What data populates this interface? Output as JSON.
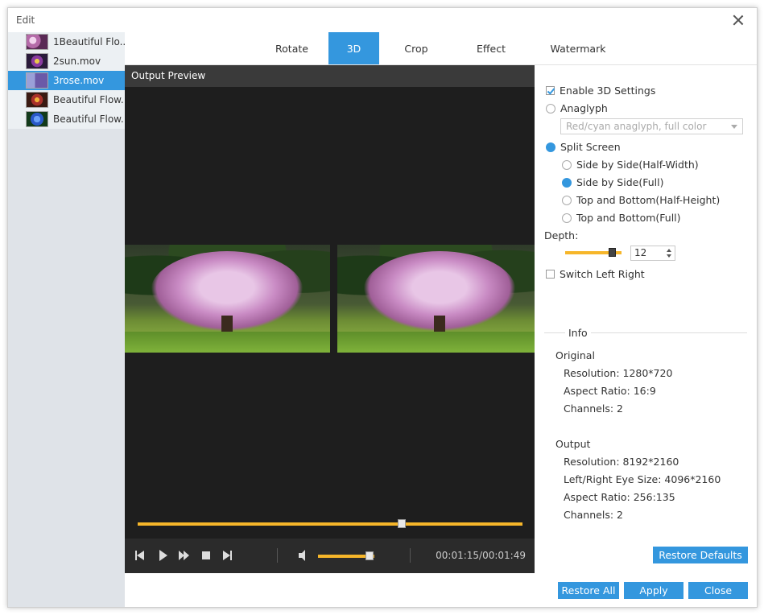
{
  "window": {
    "title": "Edit"
  },
  "files": [
    {
      "name": "1Beautiful Flo...",
      "thumb_color": "#b46aa8",
      "selected": false
    },
    {
      "name": "2sun.mov",
      "thumb_color": "#5a3a7a",
      "selected": false
    },
    {
      "name": "3rose.mov",
      "thumb_color": "#6b5aa8",
      "selected": true
    },
    {
      "name": "Beautiful Flow...",
      "thumb_color": "#7a3a2a",
      "selected": false
    },
    {
      "name": "Beautiful Flow...",
      "thumb_color": "#2a58c8",
      "selected": false
    }
  ],
  "tabs": [
    {
      "label": "Rotate",
      "active": false
    },
    {
      "label": "3D",
      "active": true
    },
    {
      "label": "Crop",
      "active": false
    },
    {
      "label": "Effect",
      "active": false
    },
    {
      "label": "Watermark",
      "active": false
    }
  ],
  "preview": {
    "header": "Output Preview",
    "progress_fraction": 0.69,
    "volume_fraction": 0.98,
    "time": "00:01:15/00:01:49"
  },
  "settings": {
    "enable_3d": {
      "label": "Enable 3D Settings",
      "checked": true
    },
    "anaglyph": {
      "label": "Anaglyph",
      "selected": false
    },
    "anaglyph_select": "Red/cyan anaglyph, full color",
    "split_screen": {
      "label": "Split Screen",
      "selected": true
    },
    "split_options": [
      {
        "label": "Side by Side(Half-Width)",
        "selected": false
      },
      {
        "label": "Side by Side(Full)",
        "selected": true
      },
      {
        "label": "Top and Bottom(Half-Height)",
        "selected": false
      },
      {
        "label": "Top and Bottom(Full)",
        "selected": false
      }
    ],
    "depth_label": "Depth:",
    "depth_value": "12",
    "depth_fraction": 0.88,
    "switch_left_right": {
      "label": "Switch Left Right",
      "checked": false
    }
  },
  "info": {
    "title": "Info",
    "original_label": "Original",
    "original": {
      "resolution": "Resolution: 1280*720",
      "aspect": "Aspect Ratio: 16:9",
      "channels": "Channels: 2"
    },
    "output_label": "Output",
    "output": {
      "resolution": "Resolution: 8192*2160",
      "eye_size": "Left/Right Eye Size: 4096*2160",
      "aspect": "Aspect Ratio: 256:135",
      "channels": "Channels: 2"
    }
  },
  "buttons": {
    "restore_defaults": "Restore Defaults",
    "restore_all": "Restore All",
    "apply": "Apply",
    "close": "Close"
  },
  "colors": {
    "accent": "#3497de",
    "slider": "#f6b62a"
  }
}
